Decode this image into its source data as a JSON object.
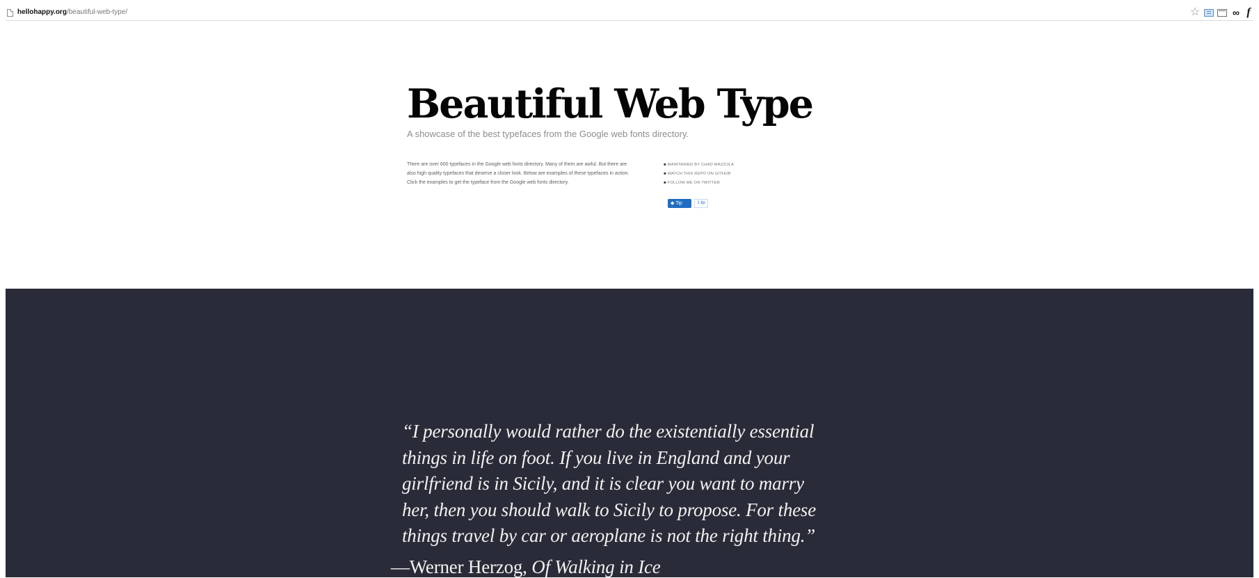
{
  "browser": {
    "url_domain": "hellohappy.org",
    "url_path": "/beautiful-web-type/",
    "icons": [
      "page-icon",
      "star-icon",
      "reader-icon",
      "window-icon",
      "glasses-icon",
      "f-icon"
    ],
    "icon_glyphs": {
      "star": "☆",
      "glasses": "∞",
      "f": "f"
    }
  },
  "hero": {
    "title": "Beautiful Web Type",
    "subtitle": "A showcase of the best typefaces from the Google web fonts directory.",
    "intro": "There are over 600 typefaces in the Google web fonts directory. Many of them are awful. But there are also high quality typefaces that deserve a closer look. Below are examples of these typefaces in action. Click the examples to get the typeface from the Google web fonts directory.",
    "links": [
      "MAINTAINED BY CHAD MAZZOLA",
      "WATCH THIS REPO ON GITHUB",
      "FOLLOW ME ON TWITTER"
    ],
    "bullet": "■",
    "tip_button_label": "Tip",
    "tip_count": "1 tip"
  },
  "quote": {
    "text": "“I personally would rather do the existentially essential\nthings in life on foot. If you live in England and your\ngirlfriend is in Sicily, and it is clear you want to marry\nher, then you should walk to Sicily to propose. For these\nthings travel by car or aeroplane is not the right thing.”",
    "author_prefix": "—Werner Herzog, ",
    "book": "Of Walking in Ice"
  },
  "colors": {
    "quote_background": "#2a2b38",
    "title_text": "#050505",
    "tip_button": "#1f6dc2"
  }
}
